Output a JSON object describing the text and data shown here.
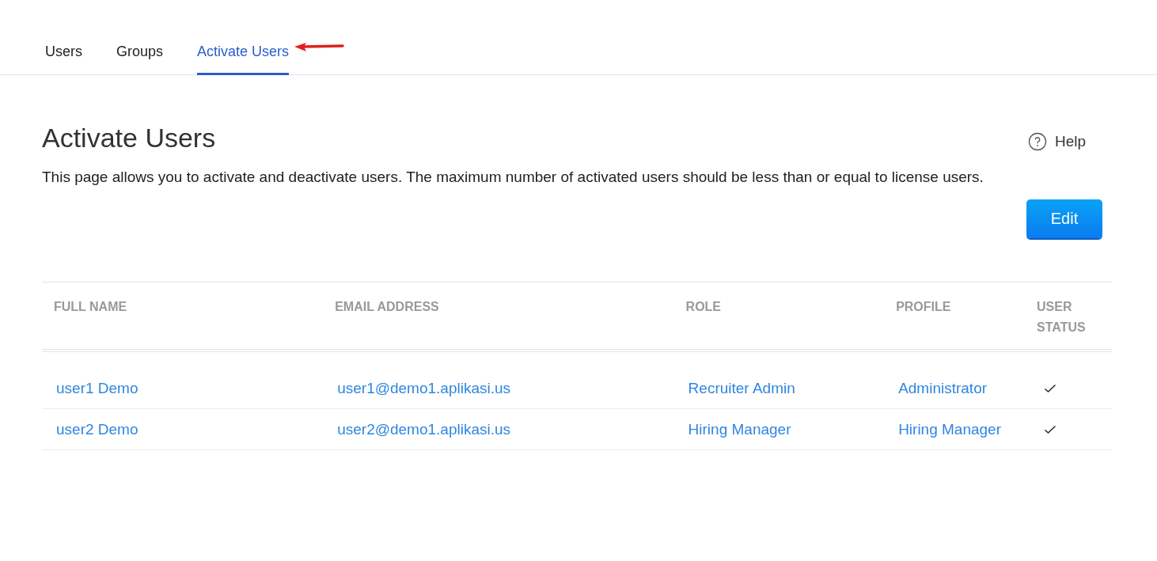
{
  "tabs": [
    {
      "label": "Users",
      "selected": false
    },
    {
      "label": "Groups",
      "selected": false
    },
    {
      "label": "Activate Users",
      "selected": true
    }
  ],
  "page": {
    "title": "Activate Users",
    "help": "Help",
    "description": "This page allows you to activate and deactivate users. The maximum number of activated users should be less than or equal to license users.",
    "edit_button": "Edit"
  },
  "table": {
    "columns": [
      "FULL NAME",
      "EMAIL ADDRESS",
      "ROLE",
      "PROFILE",
      "USER STATUS"
    ],
    "rows": [
      {
        "full_name": "user1 Demo",
        "email": "user1@demo1.aplikasi.us",
        "role": "Recruiter Admin",
        "profile": "Administrator",
        "active": true
      },
      {
        "full_name": "user2 Demo",
        "email": "user2@demo1.aplikasi.us",
        "role": "Hiring Manager",
        "profile": "Hiring Manager",
        "active": true
      }
    ]
  }
}
